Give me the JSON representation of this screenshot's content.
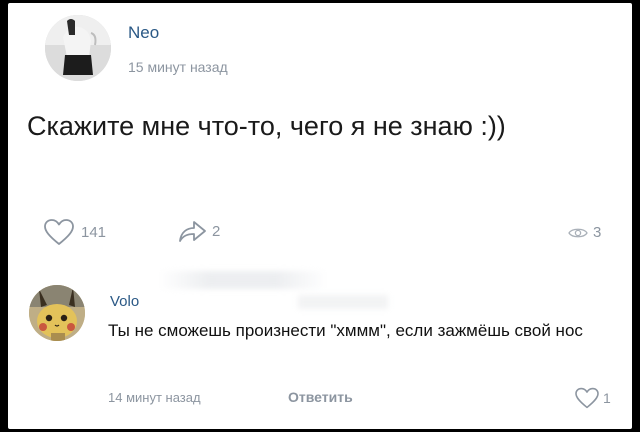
{
  "post": {
    "author": "Neo",
    "time": "15 минут назад",
    "text": "Скажите мне что-то, чего я не знаю :))",
    "likes": "141",
    "shares": "2",
    "views": "3",
    "avatar_icon": "user-photo-avatar"
  },
  "comment": {
    "author": "Volo",
    "text": "Ты не сможешь произнести \"хммм\", если зажмёшь свой нос",
    "time": "14 минут назад",
    "reply_label": "Ответить",
    "likes": "1",
    "avatar_icon": "pikachu-avatar"
  },
  "icons": {
    "like": "heart-icon",
    "share": "share-arrow-icon",
    "views": "eye-icon"
  },
  "colors": {
    "link": "#2a5885",
    "muted": "#8c95a0",
    "text": "#1a1a1a",
    "background": "#ffffff"
  }
}
